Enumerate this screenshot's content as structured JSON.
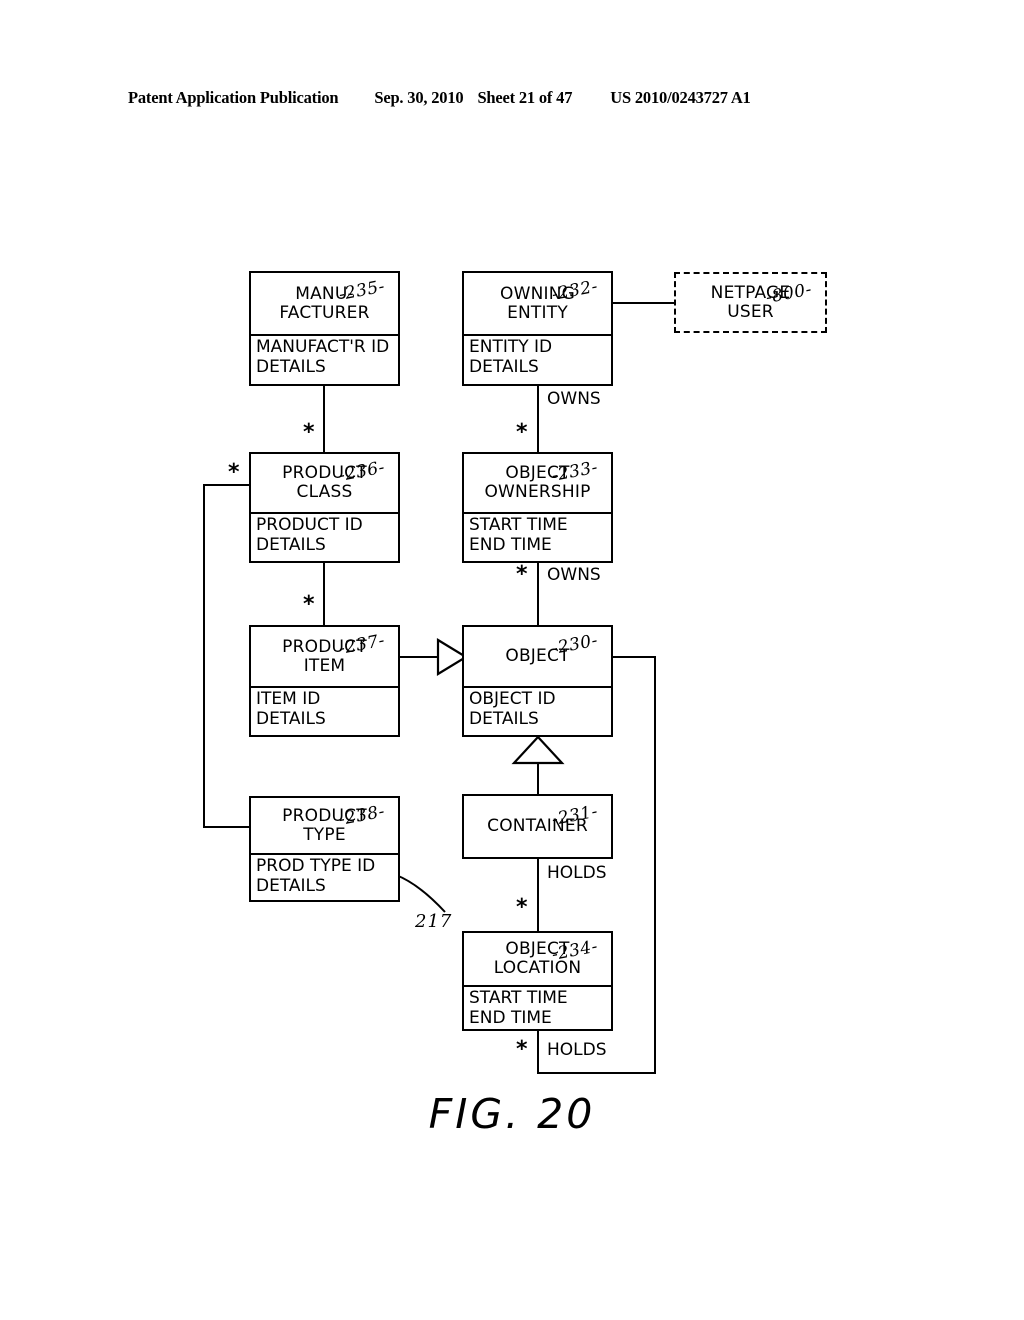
{
  "header": {
    "publication": "Patent Application Publication",
    "date": "Sep. 30, 2010",
    "sheet": "Sheet 21 of 47",
    "patent_number": "US 2010/0243727 A1"
  },
  "figure": {
    "caption": "FIG. 20",
    "type": "uml-class-diagram",
    "stroke_color": "#000000",
    "background_color": "#ffffff"
  },
  "entities": {
    "manufacturer": {
      "ref": "-235-",
      "title": "MANU-\nFACTURER",
      "attributes": "MANUFACT'R ID\nDETAILS"
    },
    "owning_entity": {
      "ref": "-232-",
      "title": "OWNING\nENTITY",
      "attributes": "ENTITY ID\nDETAILS"
    },
    "netpage_user": {
      "ref": "-800-",
      "title": "NETPAGE\nUSER",
      "attributes": ""
    },
    "product_class": {
      "ref": "-236-",
      "title": "PRODUCT\nCLASS",
      "attributes": "PRODUCT ID\nDETAILS"
    },
    "object_ownership": {
      "ref": "-233-",
      "title": "OBJECT\nOWNERSHIP",
      "attributes": "START TIME\nEND TIME"
    },
    "product_item": {
      "ref": "-237-",
      "title": "PRODUCT\nITEM",
      "attributes": "ITEM ID\nDETAILS"
    },
    "object": {
      "ref": "-230-",
      "title": "OBJECT",
      "attributes": "OBJECT ID\nDETAILS"
    },
    "product_type": {
      "ref": "-238-",
      "title": "PRODUCT\nTYPE",
      "attributes": "PROD TYPE ID\nDETAILS"
    },
    "container": {
      "ref": "-231-",
      "title": "CONTAINER",
      "attributes": ""
    },
    "object_location": {
      "ref": "-234-",
      "title": "OBJECT\nLOCATION",
      "attributes": "START TIME\nEND TIME"
    }
  },
  "relationship_labels": {
    "owns_entity_to_ownership": "OWNS",
    "owns_ownership_to_object": "OWNS",
    "holds_container_to_location": "HOLDS",
    "holds_location_to_object": "HOLDS",
    "multiplicity_star": "*"
  },
  "callouts": {
    "prod_type_id_ref": "217"
  }
}
